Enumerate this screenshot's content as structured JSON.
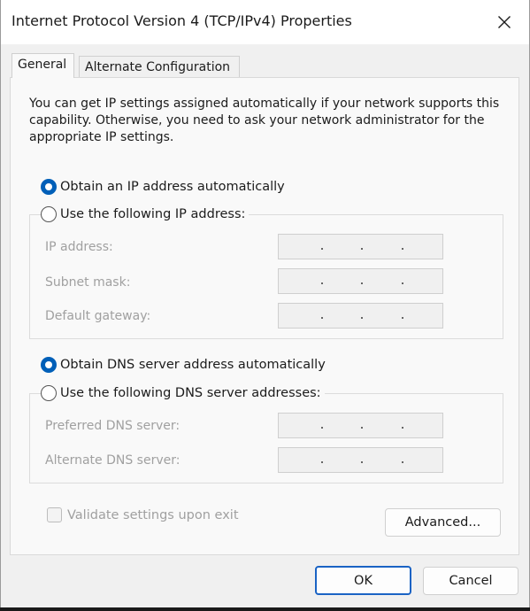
{
  "window": {
    "title": "Internet Protocol Version 4 (TCP/IPv4) Properties"
  },
  "tabs": [
    {
      "label": "General",
      "active": true
    },
    {
      "label": "Alternate Configuration",
      "active": false
    }
  ],
  "general": {
    "description": "You can get IP settings assigned automatically if your network supports this capability. Otherwise, you need to ask your network administrator for the appropriate IP settings.",
    "ip_auto_label": "Obtain an IP address automatically",
    "ip_manual_label": "Use the following IP address:",
    "ip_fields": [
      {
        "label": "IP address:",
        "value": "  .  .  ."
      },
      {
        "label": "Subnet mask:",
        "value": "  .  .  ."
      },
      {
        "label": "Default gateway:",
        "value": "  .  .  ."
      }
    ],
    "dns_auto_label": "Obtain DNS server address automatically",
    "dns_manual_label": "Use the following DNS server addresses:",
    "dns_fields": [
      {
        "label": "Preferred DNS server:",
        "value": "  .  .  ."
      },
      {
        "label": "Alternate DNS server:",
        "value": "  .  .  ."
      }
    ],
    "validate_label": "Validate settings upon exit",
    "advanced_label": "Advanced..."
  },
  "footer": {
    "ok_label": "OK",
    "cancel_label": "Cancel"
  },
  "icons": {
    "close": "close-icon"
  },
  "colors": {
    "accent": "#005fb8",
    "default_button_border": "#1a63c4",
    "disabled_text": "#a0a0a0"
  }
}
